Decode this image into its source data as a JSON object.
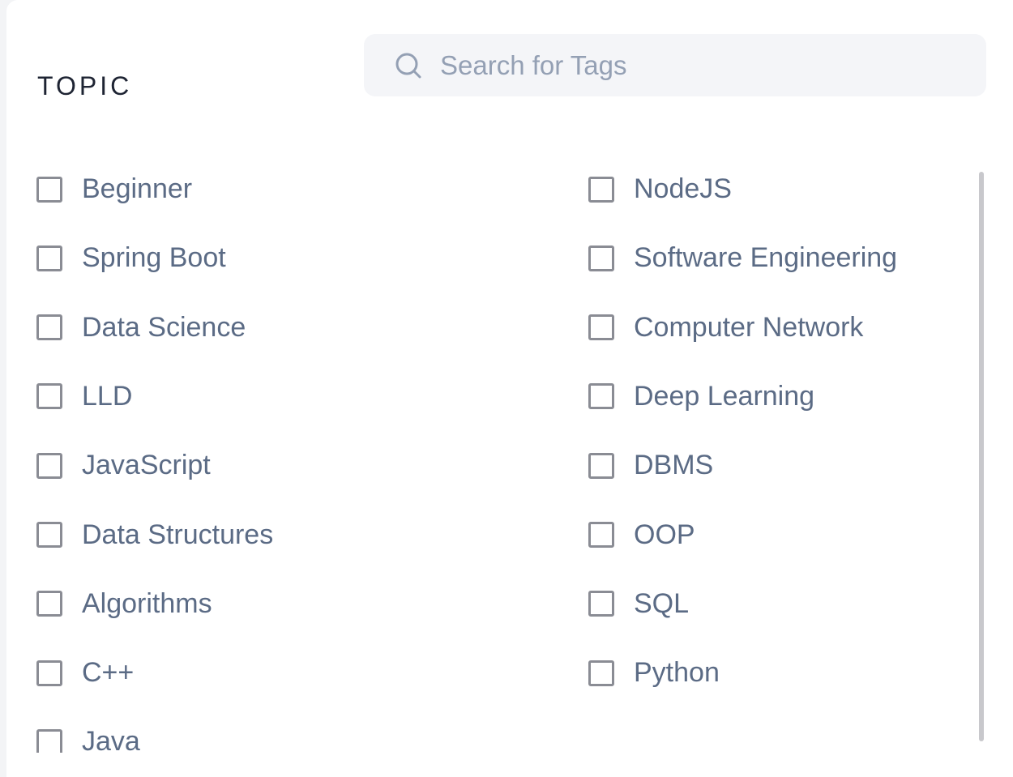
{
  "section_title": "TOPIC",
  "search": {
    "placeholder": "Search for Tags",
    "value": ""
  },
  "tags_left": [
    "Beginner",
    "Spring Boot",
    "Data Science",
    "LLD",
    "JavaScript",
    "Data Structures",
    "Algorithms",
    "C++",
    "Java"
  ],
  "tags_right": [
    "NodeJS",
    "Software Engineering",
    "Computer Network",
    "Deep Learning",
    "DBMS",
    "OOP",
    "SQL",
    "Python"
  ],
  "colors": {
    "title": "#1e2433",
    "label": "#5b6b85",
    "checkbox_border": "#8a8c94",
    "search_bg": "#f4f5f8",
    "placeholder": "#94a0b4"
  },
  "icons": {
    "search": "search-icon"
  }
}
